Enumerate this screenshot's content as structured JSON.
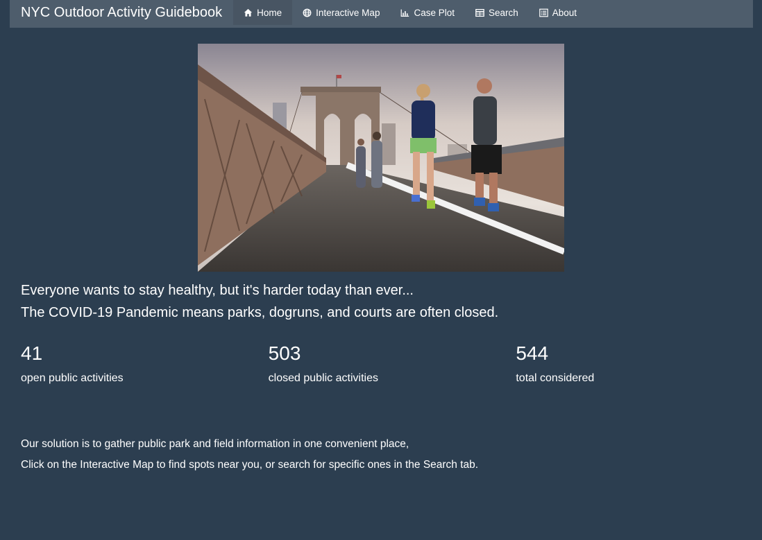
{
  "navbar": {
    "brand": "NYC Outdoor Activity Guidebook",
    "items": [
      {
        "label": "Home",
        "icon": "home-icon",
        "active": true
      },
      {
        "label": "Interactive Map",
        "icon": "globe-icon",
        "active": false
      },
      {
        "label": "Case Plot",
        "icon": "bar-chart-icon",
        "active": false
      },
      {
        "label": "Search",
        "icon": "table-icon",
        "active": false
      },
      {
        "label": "About",
        "icon": "list-alt-icon",
        "active": false
      }
    ]
  },
  "hero": {
    "alt": "People jogging on the Brooklyn Bridge"
  },
  "headline": {
    "line1": "Everyone wants to stay healthy, but it's harder today than ever...",
    "line2": "The COVID-19 Pandemic means parks, dogruns, and courts are often closed."
  },
  "stats": [
    {
      "value": "41",
      "label": "open public activities"
    },
    {
      "value": "503",
      "label": "closed public activities"
    },
    {
      "value": "544",
      "label": "total considered"
    }
  ],
  "solution": {
    "line1": "Our solution is to gather public park and field information in one convenient place,",
    "line2": "Click on the Interactive Map to find spots near you, or search for specific ones in the Search tab."
  },
  "colors": {
    "background": "#2c3e50",
    "navbar": "#4e5d6c",
    "navbar_active": "#485563",
    "text": "#ffffff"
  }
}
